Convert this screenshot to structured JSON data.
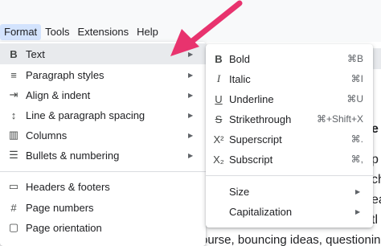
{
  "menubar": {
    "items": [
      {
        "label": "Format",
        "active": true
      },
      {
        "label": "Tools"
      },
      {
        "label": "Extensions"
      },
      {
        "label": "Help"
      }
    ]
  },
  "format_menu": {
    "items": [
      {
        "label": "Text",
        "icon": "bold-b-icon",
        "glyph": "B",
        "has_submenu": true,
        "highlighted": true
      },
      {
        "label": "Paragraph styles",
        "icon": "paragraph-styles-icon",
        "glyph": "≡",
        "has_submenu": true
      },
      {
        "label": "Align & indent",
        "icon": "align-indent-icon",
        "glyph": "⇥",
        "has_submenu": true
      },
      {
        "label": "Line & paragraph spacing",
        "icon": "line-spacing-icon",
        "glyph": "↕",
        "has_submenu": true
      },
      {
        "label": "Columns",
        "icon": "columns-icon",
        "glyph": "▥",
        "has_submenu": true
      },
      {
        "label": "Bullets & numbering",
        "icon": "bulleted-list-icon",
        "glyph": "☰",
        "has_submenu": true
      },
      {
        "label": "Headers & footers",
        "icon": "headers-footers-icon",
        "glyph": "▭",
        "has_submenu": false
      },
      {
        "label": "Page numbers",
        "icon": "hash-icon",
        "glyph": "#",
        "has_submenu": false
      },
      {
        "label": "Page orientation",
        "icon": "page-orientation-icon",
        "glyph": "▢",
        "has_submenu": false
      }
    ]
  },
  "text_submenu": {
    "items": [
      {
        "label": "Bold",
        "icon": "bold-icon",
        "glyph": "B",
        "shortcut": "⌘B"
      },
      {
        "label": "Italic",
        "icon": "italic-icon",
        "glyph": "I",
        "shortcut": "⌘I"
      },
      {
        "label": "Underline",
        "icon": "underline-icon",
        "glyph": "U",
        "shortcut": "⌘U"
      },
      {
        "label": "Strikethrough",
        "icon": "strikethrough-icon",
        "glyph": "S",
        "shortcut": "⌘+Shift+X"
      },
      {
        "label": "Superscript",
        "icon": "superscript-icon",
        "glyph": "X²",
        "shortcut": "⌘."
      },
      {
        "label": "Subscript",
        "icon": "subscript-icon",
        "glyph": "X₂",
        "shortcut": "⌘,"
      }
    ],
    "extra_items": [
      {
        "label": "Size",
        "has_submenu": true
      },
      {
        "label": "Capitalization",
        "has_submenu": true
      }
    ]
  },
  "document": {
    "visible_text_bottom": "ourse, bouncing ideas, questioning r",
    "right_fragments": [
      "e S",
      "p",
      "ch",
      "ea",
      "e",
      "tl",
      "ea"
    ]
  },
  "colors": {
    "accent_arrow": "#e8336e",
    "menu_highlight": "#e8eaed",
    "active_menubar": "#d3e3fd"
  }
}
